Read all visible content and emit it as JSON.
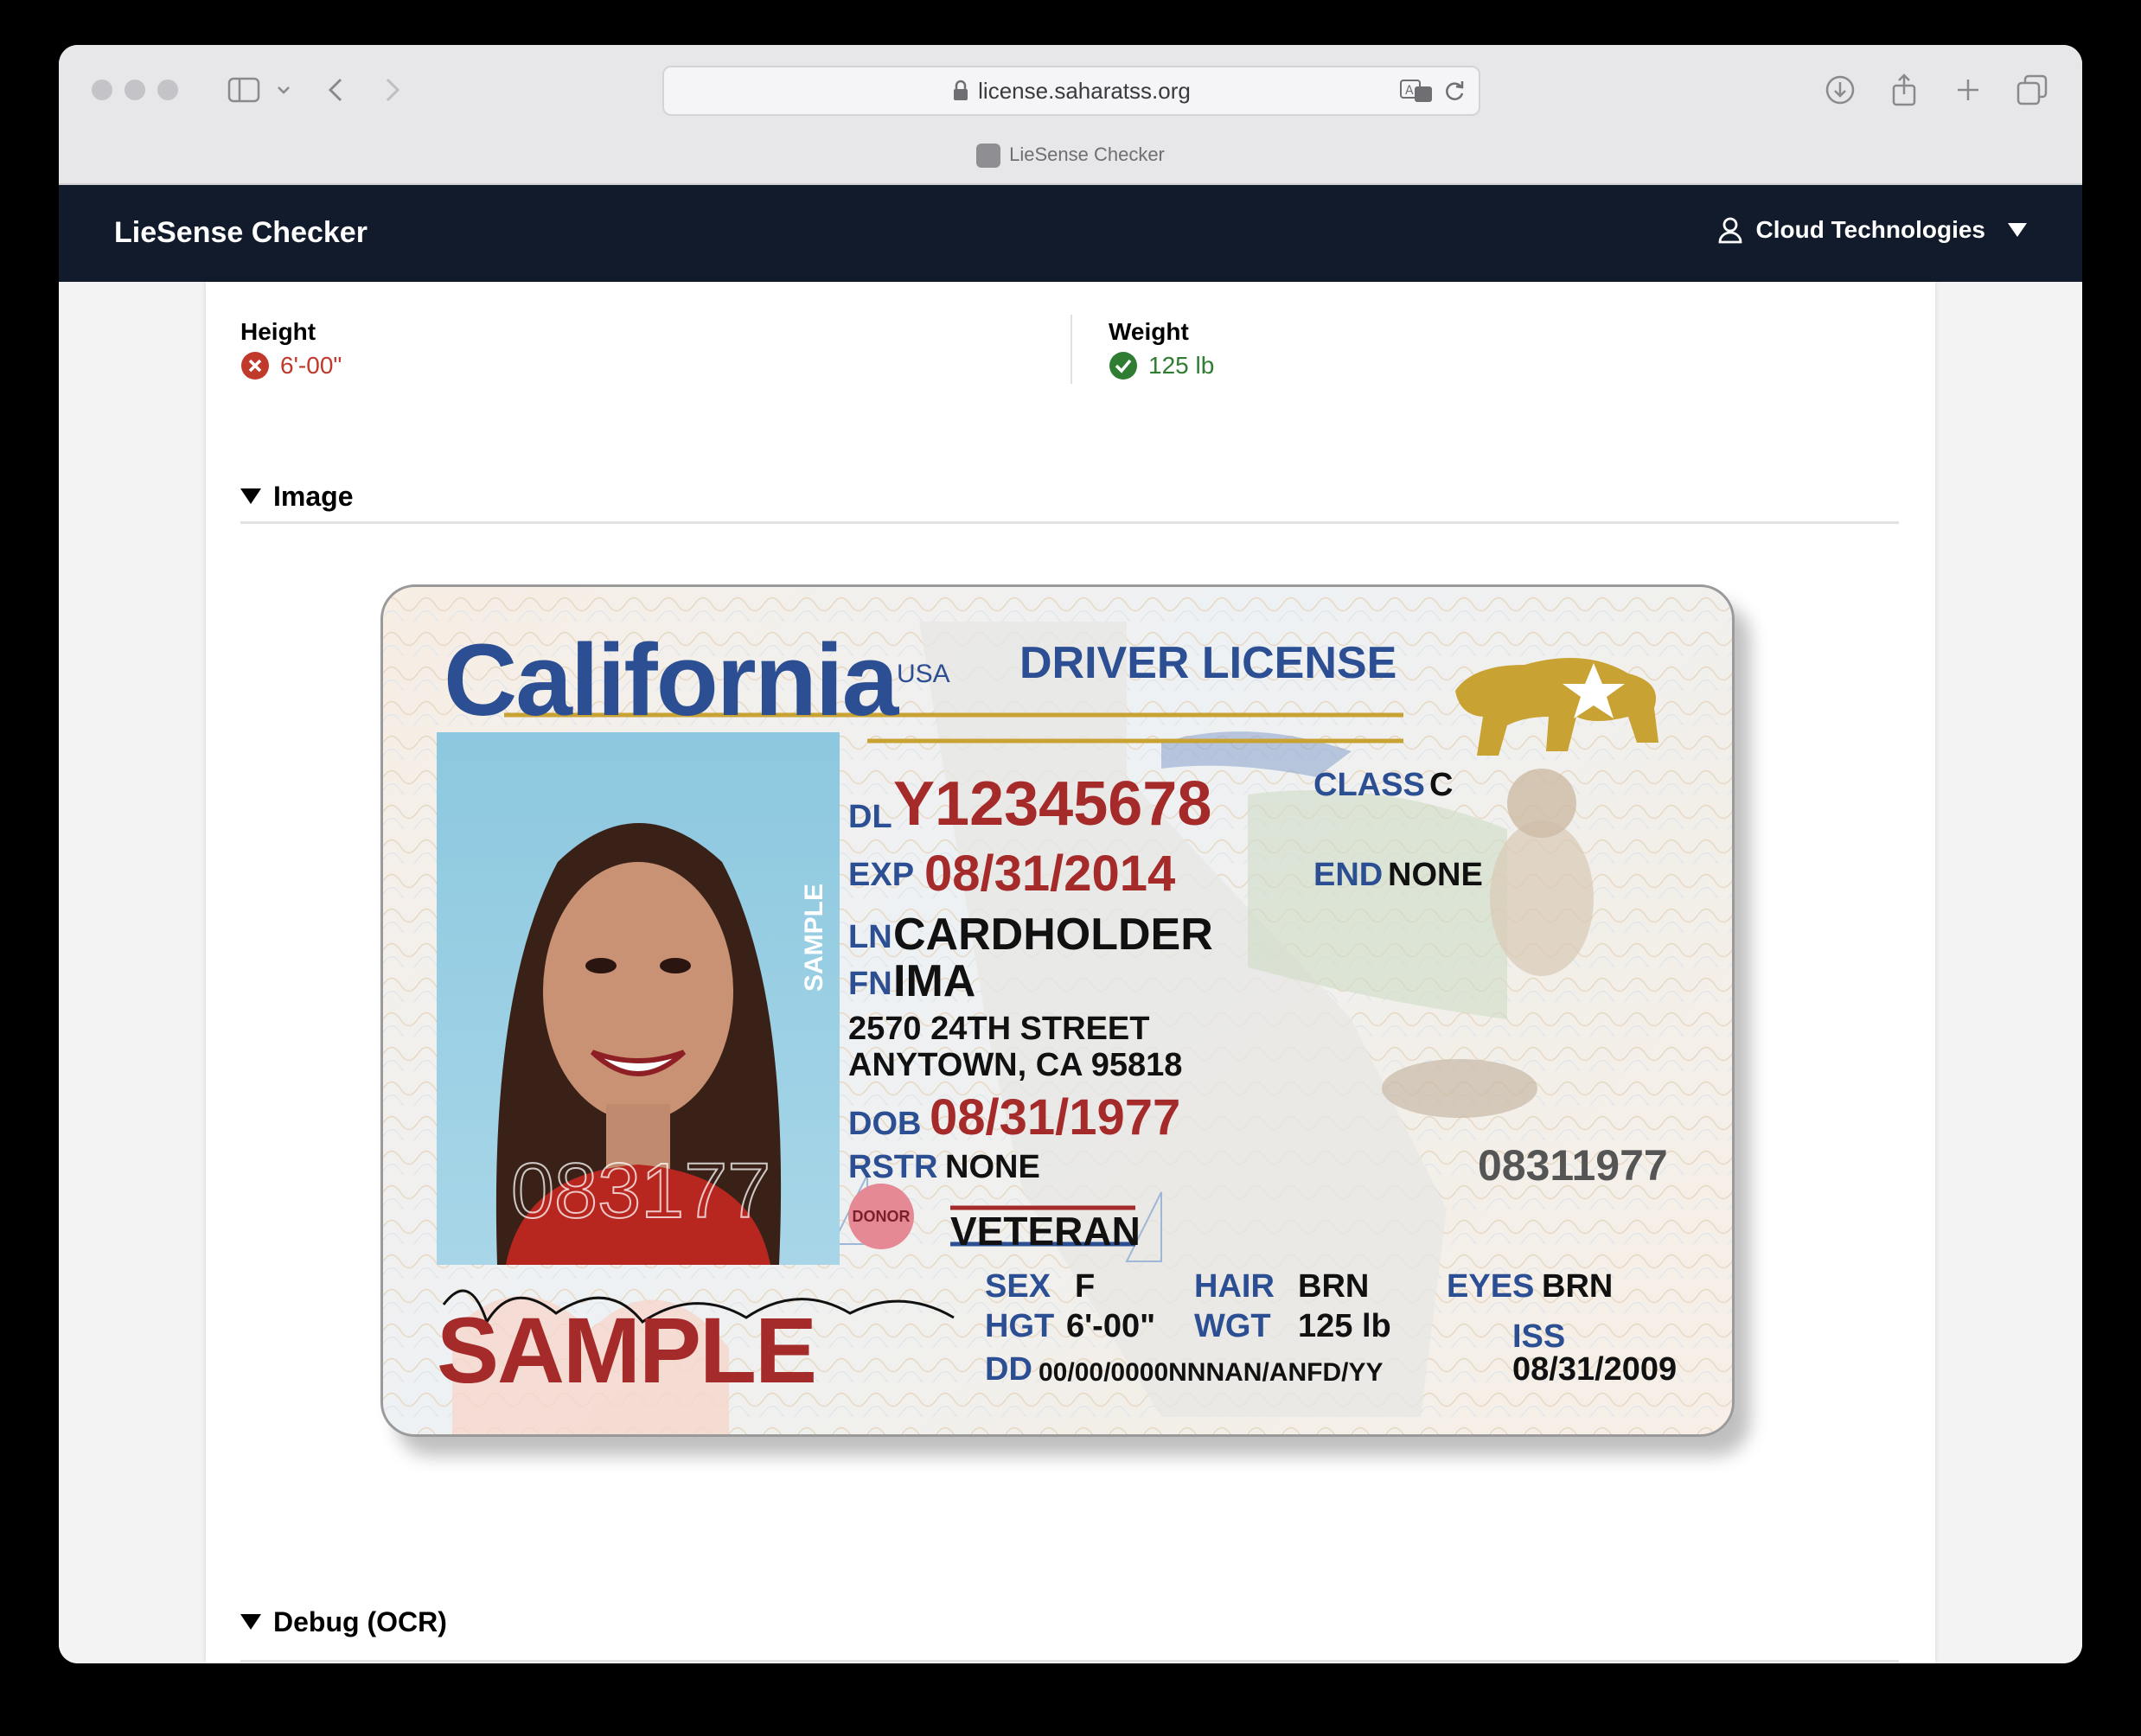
{
  "browser": {
    "url": "license.saharatss.org",
    "tab_title": "LieSense Checker"
  },
  "navbar": {
    "brand": "LieSense Checker",
    "user": "Cloud Technologies"
  },
  "fields": {
    "height": {
      "label": "Height",
      "value": "6'-00\"",
      "status": "invalid",
      "color": "#c0392b"
    },
    "weight": {
      "label": "Weight",
      "value": "125 lb",
      "status": "valid",
      "color": "#2e7d32"
    }
  },
  "sections": {
    "image": "Image",
    "debug": "Debug (OCR)"
  },
  "license": {
    "state": "California",
    "country": "USA",
    "doc_type": "DRIVER LICENSE",
    "dl_label": "DL",
    "dl_number": "Y12345678",
    "exp_label": "EXP",
    "exp": "08/31/2014",
    "ln_label": "LN",
    "last_name": "CARDHOLDER",
    "fn_label": "FN",
    "first_name": "IMA",
    "address1": "2570 24TH STREET",
    "address2": "ANYTOWN, CA 95818",
    "dob_label": "DOB",
    "dob": "08/31/1977",
    "rstr_label": "RSTR",
    "rstr": "NONE",
    "class_label": "CLASS",
    "class": "C",
    "end_label": "END",
    "end": "NONE",
    "donor": "DONOR",
    "veteran": "VETERAN",
    "sex_label": "SEX",
    "sex": "F",
    "hair_label": "HAIR",
    "hair": "BRN",
    "eyes_label": "EYES",
    "eyes": "BRN",
    "hgt_label": "HGT",
    "hgt": "6'-00\"",
    "wgt_label": "WGT",
    "wgt": "125 lb",
    "iss_label": "ISS",
    "iss": "08/31/2009",
    "dd_label": "DD",
    "dd": "00/00/0000NNNAN/ANFD/YY",
    "ghost_number": "08311977",
    "photo_ghost": "083177",
    "photo_side": "SAMPLE",
    "sample_stamp": "SAMPLE",
    "signature": "Ima Cardholder"
  }
}
